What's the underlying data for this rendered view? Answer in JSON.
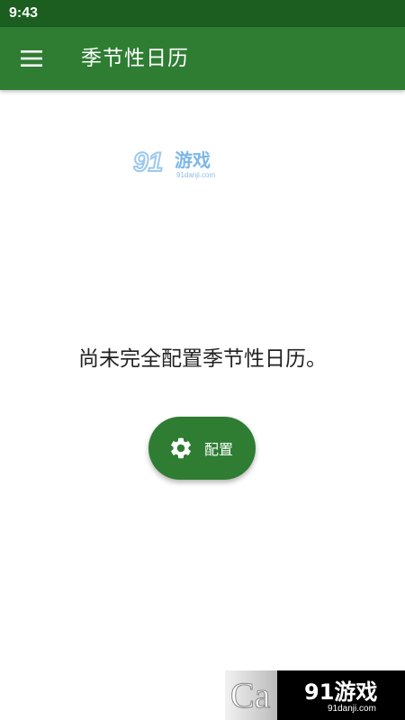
{
  "status_bar": {
    "time": "9:43"
  },
  "app_bar": {
    "title": "季节性日历",
    "menu_icon": "hamburger-menu-icon"
  },
  "watermark": {
    "brand": "91",
    "brand_text": "游戏",
    "url": "91danji.com",
    "corner_text": "91游戏",
    "corner_url": "91danji.com",
    "corner_ghost": "Ca"
  },
  "main": {
    "message": "尚未完全配置季节性日历。",
    "config_button": {
      "label": "配置",
      "icon": "gear-icon"
    }
  },
  "colors": {
    "status_bar": "#1b5e20",
    "primary": "#2e7d32",
    "background": "#ffffff",
    "text": "#222222"
  }
}
